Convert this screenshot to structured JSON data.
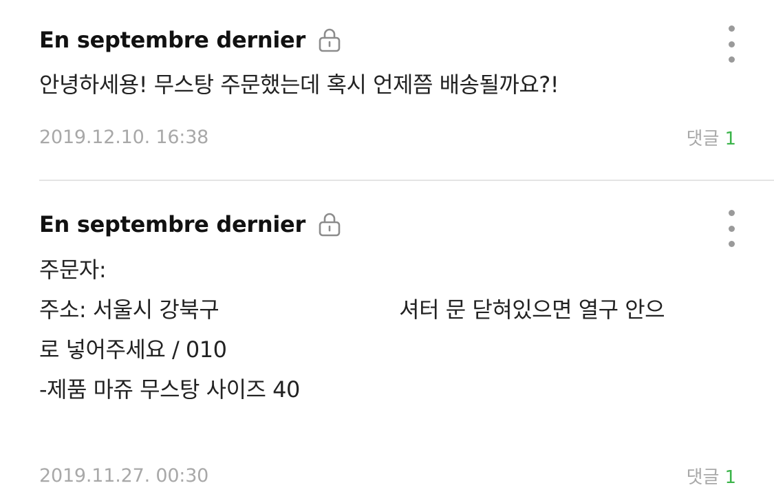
{
  "posts": [
    {
      "author": "En septembre dernier",
      "lock_icon": "lock-icon",
      "more_icon": "more-vertical-icon",
      "lines": [
        "안녕하세용! 무스탕 주문했는데 혹시 언제쯤 배송될까요?!"
      ],
      "timestamp": "2019.12.10. 16:38",
      "comment_label": "댓글",
      "comment_count": "1"
    },
    {
      "author": "En septembre dernier",
      "lock_icon": "lock-icon",
      "more_icon": "more-vertical-icon",
      "line1": "주문자:",
      "line2_start": "주소: 서울시 강북구",
      "line2_end": "셔터 문 닫혀있으면 열구 안으",
      "line3": "로 넣어주세요 / 010",
      "line4": "-제품 마쥬 무스탕 사이즈 40",
      "timestamp": "2019.11.27. 00:30",
      "comment_label": "댓글",
      "comment_count": "1"
    }
  ],
  "colors": {
    "author": "#111111",
    "body": "#222222",
    "meta": "#a8a8a8",
    "accent": "#3bb44a",
    "divider": "#e4e4e4"
  }
}
